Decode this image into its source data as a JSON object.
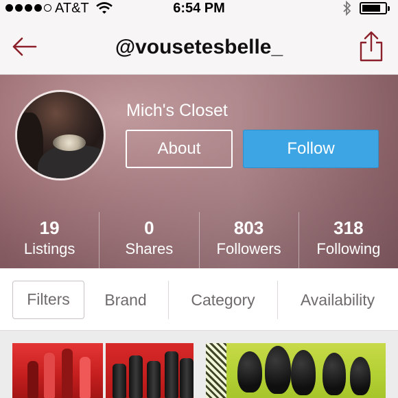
{
  "status_bar": {
    "carrier": "AT&T",
    "time": "6:54 PM",
    "signal_bars": 4,
    "signal_total": 5,
    "battery_level": 0.75
  },
  "nav": {
    "title": "@vousetesbelle_",
    "back_icon": "back-arrow-icon",
    "share_icon": "share-icon"
  },
  "profile": {
    "closet_name": "Mich's Closet",
    "about_label": "About",
    "follow_label": "Follow",
    "stats": [
      {
        "value": "19",
        "label": "Listings"
      },
      {
        "value": "0",
        "label": "Shares"
      },
      {
        "value": "803",
        "label": "Followers"
      },
      {
        "value": "318",
        "label": "Following"
      }
    ]
  },
  "filters": {
    "items": [
      "Filters",
      "Brand",
      "Category",
      "Availability"
    ],
    "selected": "Filters"
  },
  "colors": {
    "accent": "#3da5e3",
    "nav_icon": "#8b1f2a"
  }
}
